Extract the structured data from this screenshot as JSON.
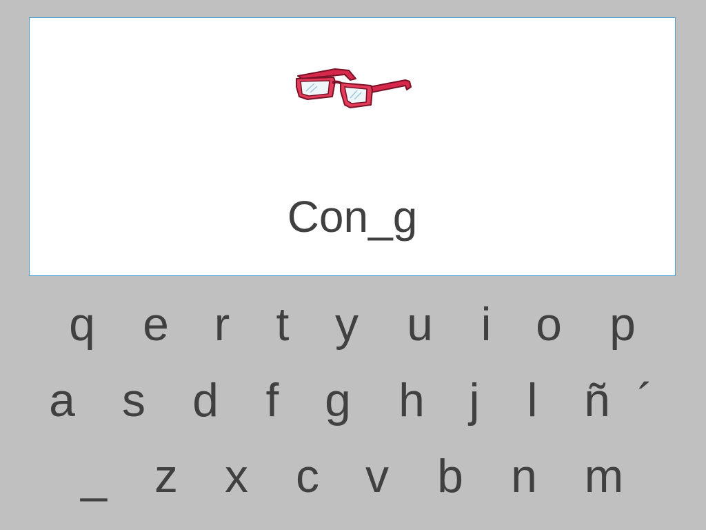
{
  "word": "Con_g",
  "image": {
    "icon": "red-eyeglasses-icon"
  },
  "keyboard": {
    "row1": [
      "q",
      "e",
      "r",
      "t",
      "y",
      "u",
      "i",
      "o",
      "p"
    ],
    "row2": [
      "a",
      "s",
      "d",
      "f",
      "g",
      "h",
      "j",
      "l",
      "ñ",
      "´"
    ],
    "row3": [
      "_",
      "z",
      "x",
      "c",
      "v",
      "b",
      "n",
      "m"
    ]
  },
  "colors": {
    "background": "#c0c0c0",
    "text": "#404040",
    "glasses_frame": "#d6284a"
  }
}
